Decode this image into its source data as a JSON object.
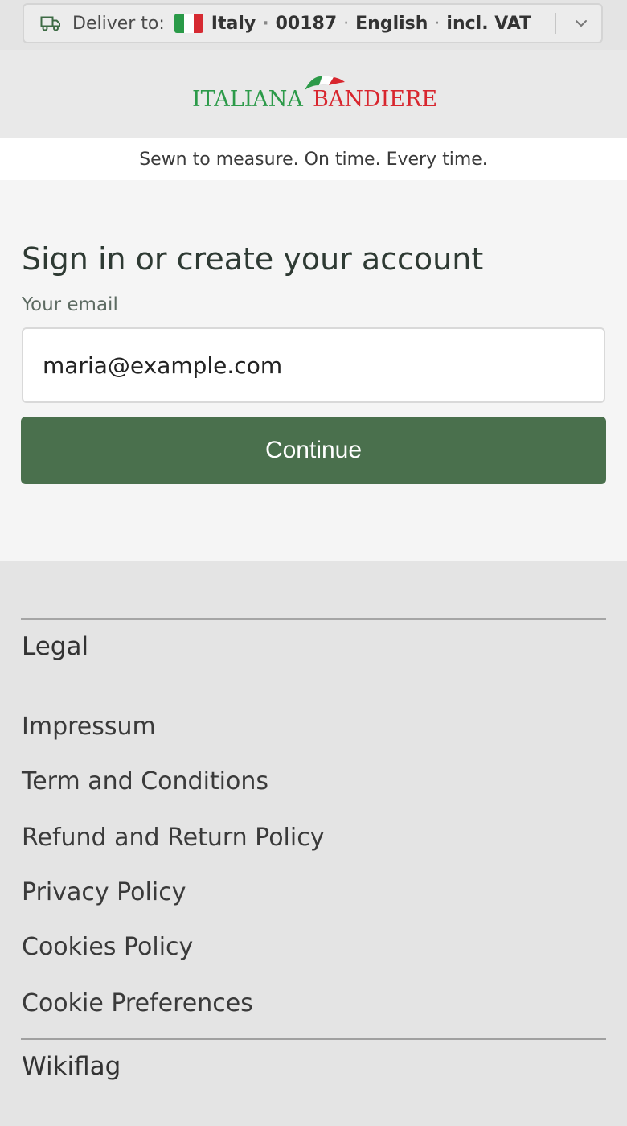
{
  "delivery": {
    "label": "Deliver to:",
    "country": "Italy",
    "postcode": "00187",
    "language": "English",
    "tax": "incl. VAT",
    "separator": "·",
    "flag_colors": [
      "#2a9a48",
      "#ffffff",
      "#d62a32"
    ],
    "icons": [
      "truck-icon",
      "flag-icon",
      "chevron-down-icon"
    ]
  },
  "brand": {
    "name_part1": "ITALIANA",
    "name_part2": "BANDIERE",
    "color_green": "#2c9a49",
    "color_red": "#d8262e"
  },
  "tagline": "Sewn to measure. On time. Every time.",
  "signin": {
    "title": "Sign in or create your account",
    "email_label": "Your email",
    "email_value": "maria@example.com",
    "continue_label": "Continue",
    "button_color": "#4a704d"
  },
  "footer": {
    "legal_heading": "Legal",
    "legal_links": [
      "Impressum",
      "Term and Conditions",
      "Refund and Return Policy",
      "Privacy Policy",
      "Cookies Policy",
      "Cookie Preferences"
    ],
    "wikiflag_heading": "Wikiflag"
  }
}
